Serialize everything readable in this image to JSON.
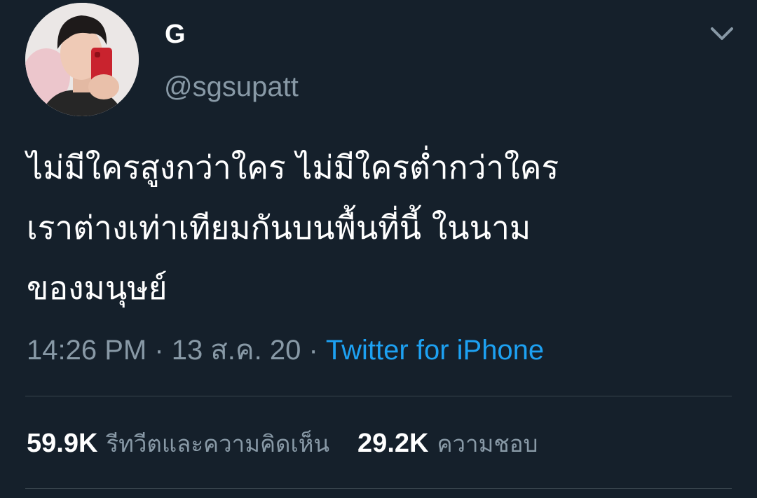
{
  "author": {
    "display_name": "G",
    "handle": "@sgsupatt"
  },
  "tweet": {
    "lines": [
      "ไม่มีใครสูงกว่าใคร ไม่มีใครต่ำกว่าใคร",
      "เราต่างเท่าเทียมกันบนพื้นที่นี้ ในนาม",
      "ของมนุษย์"
    ]
  },
  "meta": {
    "time": "14:26 PM",
    "separator": " · ",
    "date": "13 ส.ค. 20",
    "source": "Twitter for iPhone"
  },
  "stats": {
    "retweets_count": "59.9K",
    "retweets_label": "รีทวีตและความคิดเห็น",
    "likes_count": "29.2K",
    "likes_label": "ความชอบ"
  },
  "colors": {
    "background": "#15202b",
    "secondary_text": "#8899a6",
    "link": "#1da1f2",
    "divider": "#38444d"
  },
  "icons": {
    "more": "chevron-down-icon"
  }
}
